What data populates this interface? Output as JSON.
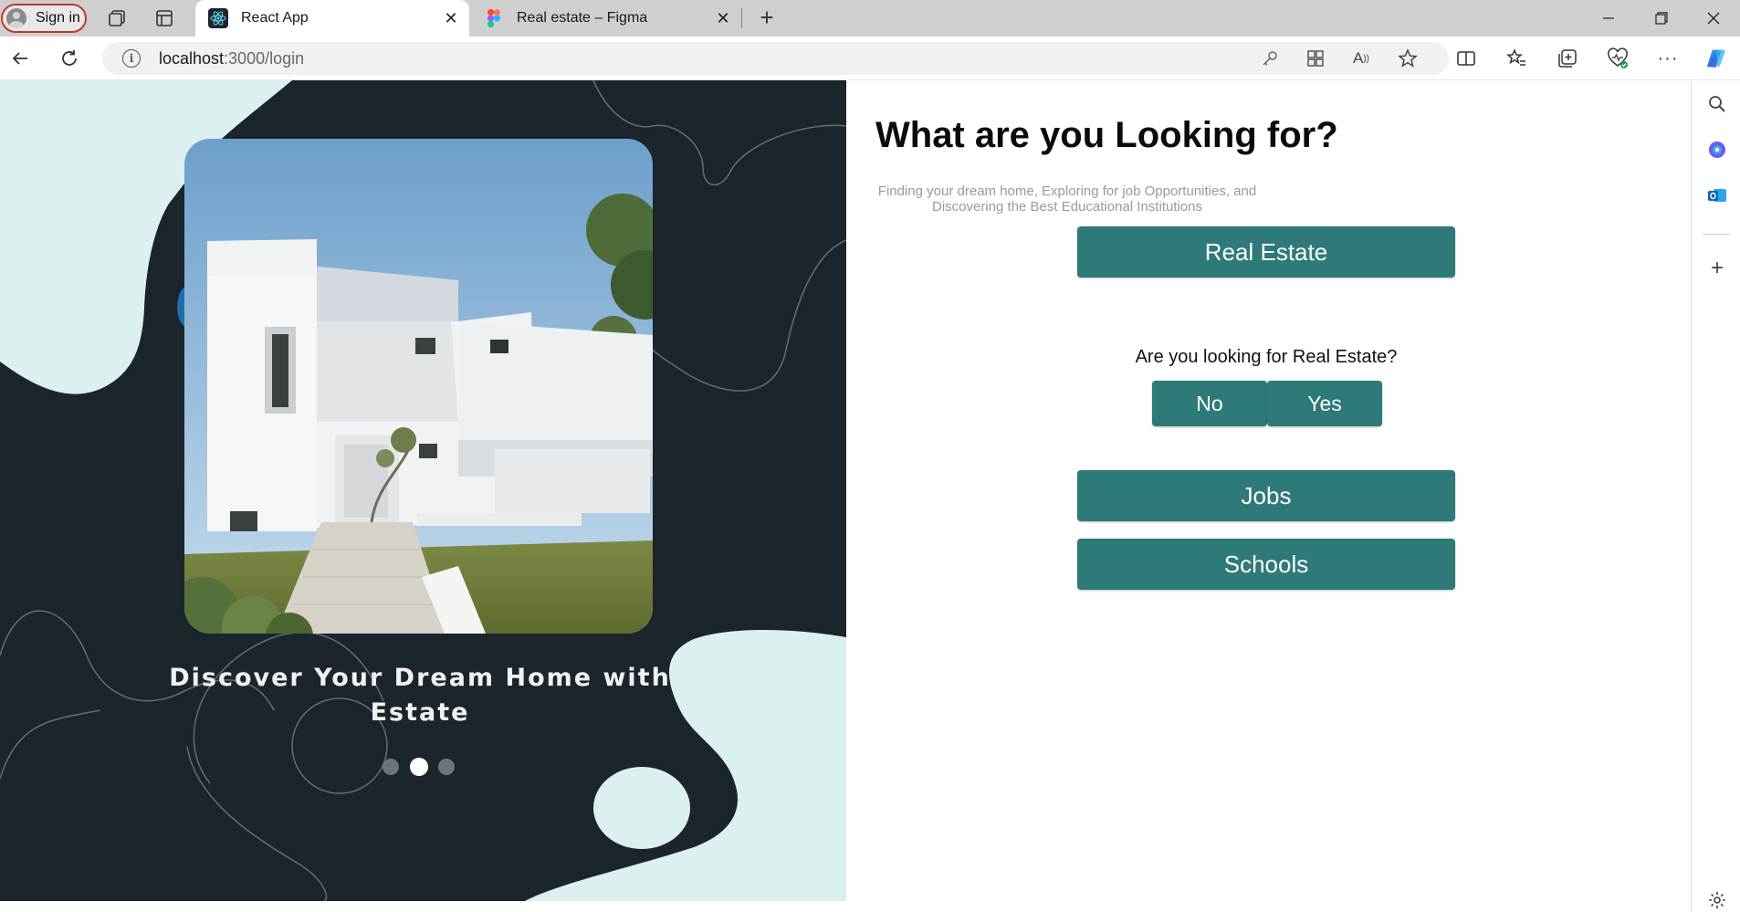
{
  "browser": {
    "signin_label": "Sign in",
    "tabs": [
      {
        "title": "React App",
        "icon": "react-icon"
      },
      {
        "title": "Real estate – Figma",
        "icon": "figma-icon"
      }
    ],
    "url_host": "localhost",
    "url_path": ":3000/login"
  },
  "hero": {
    "title": "Discover Your Dream Home with Estate",
    "carousel": {
      "total": 3,
      "active": 2
    },
    "colors": {
      "bg": "#1b252b",
      "blob": "#dcf0ef"
    }
  },
  "main": {
    "heading": "What are you Looking for?",
    "subtitle": "Finding your dream home, Exploring for job Opportunities, and Discovering the Best Educational Institutions",
    "real_estate_label": "Real Estate",
    "question": "Are you looking for Real Estate?",
    "no_label": "No",
    "yes_label": "Yes",
    "jobs_label": "Jobs",
    "schools_label": "Schools",
    "accent": "#2d7a78"
  }
}
